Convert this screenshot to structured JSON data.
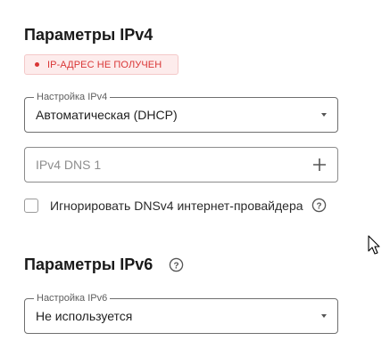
{
  "ipv4": {
    "title": "Параметры IPv4",
    "status_badge": "IP-АДРЕС НЕ ПОЛУЧЕН",
    "status_color": "#d93636",
    "setting": {
      "legend": "Настройка IPv4",
      "value": "Автоматическая (DHCP)"
    },
    "dns_field": {
      "placeholder": "IPv4 DNS 1",
      "value": "",
      "add_icon": "plus-icon"
    },
    "ignore_isp_dns": {
      "label": "Игнорировать DNSv4 интернет-провайдера",
      "checked": false,
      "help_icon": "help-circle-icon"
    }
  },
  "ipv6": {
    "title": "Параметры IPv6",
    "help_icon": "help-circle-icon",
    "setting": {
      "legend": "Настройка IPv6",
      "value": "Не используется"
    }
  }
}
